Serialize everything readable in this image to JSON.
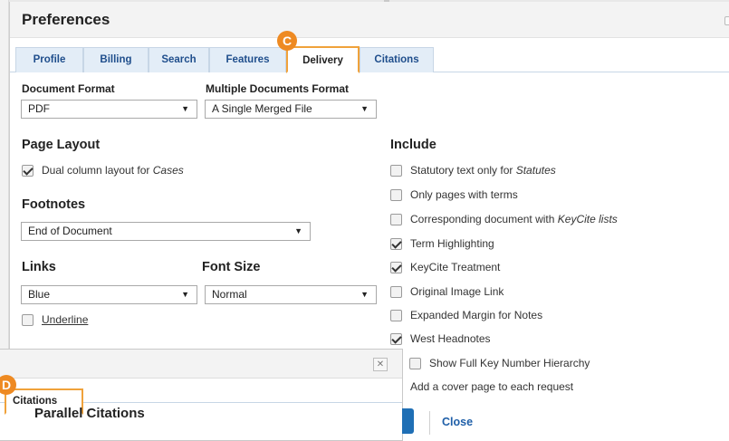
{
  "dialog": {
    "title": "Preferences"
  },
  "tabs": [
    "Profile",
    "Billing",
    "Search",
    "Features",
    "Delivery",
    "Citations"
  ],
  "active_tab": "Delivery",
  "badges": {
    "c": "C",
    "d": "D"
  },
  "document_format": {
    "label": "Document Format",
    "value": "PDF"
  },
  "multiple_documents_format": {
    "label": "Multiple Documents Format",
    "value": "A Single Merged File"
  },
  "page_layout": {
    "heading": "Page Layout",
    "dual_column": {
      "text": "Dual column layout for ",
      "italic": "Cases",
      "checked": true
    }
  },
  "footnotes": {
    "heading": "Footnotes",
    "value": "End of Document"
  },
  "links": {
    "heading": "Links",
    "value": "Blue"
  },
  "font_size": {
    "heading": "Font Size",
    "value": "Normal"
  },
  "underline": {
    "label": "Underline",
    "checked": false
  },
  "include": {
    "heading": "Include",
    "statutory": {
      "text": "Statutory text only for ",
      "italic": "Statutes",
      "checked": false
    },
    "only_pages": {
      "text": "Only pages with terms",
      "checked": false
    },
    "corresponding": {
      "text": "Corresponding document with ",
      "italic": "KeyCite lists",
      "checked": false
    },
    "term_highlighting": {
      "text": "Term Highlighting",
      "checked": true
    },
    "keycite_treatment": {
      "text": "KeyCite Treatment",
      "checked": true
    },
    "original_image": {
      "text": "Original Image Link",
      "checked": false
    },
    "expanded_margin": {
      "text": "Expanded Margin for Notes",
      "checked": false
    },
    "west_headnotes": {
      "text": "West Headnotes",
      "checked": true
    },
    "full_key_number": {
      "text": "Show Full Key Number Hierarchy",
      "checked": false
    },
    "cover_page": {
      "text": "Add a cover page to each request"
    }
  },
  "citations_dialog": {
    "close_symbol": "✕",
    "tab": "Citations",
    "section": "Parallel Citations"
  },
  "footer": {
    "close_label": "Close"
  },
  "icons": {
    "caret": "▼"
  },
  "colors": {
    "accent_orange": "#f0a23b",
    "badge_orange": "#ee8a22",
    "tab_blue": "#e3edf7",
    "link_blue": "#1f5fa8",
    "primary_blue": "#1f6fb5"
  }
}
